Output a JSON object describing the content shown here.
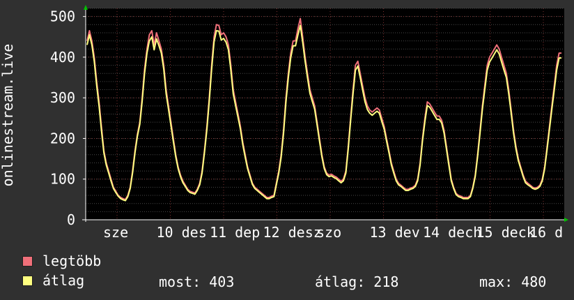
{
  "chart_data": {
    "type": "line",
    "ylabel": "onlinestream.live",
    "ylim": [
      0,
      520
    ],
    "y_ticks": [
      "0",
      "100",
      "200",
      "300",
      "400",
      "500"
    ],
    "x_ticks": [
      "sze",
      "10 des",
      "11 dep",
      "12 desz",
      "szo",
      "13 dev",
      "14 dech",
      "15 deck",
      "16 d"
    ],
    "grid": true,
    "series": [
      {
        "name": "legtöbb",
        "color": "#f0707a",
        "values": [
          440,
          465,
          440,
          400,
          340,
          290,
          230,
          170,
          140,
          120,
          100,
          80,
          70,
          60,
          55,
          52,
          50,
          60,
          80,
          120,
          170,
          210,
          240,
          300,
          370,
          420,
          455,
          465,
          430,
          460,
          440,
          420,
          380,
          320,
          280,
          240,
          200,
          160,
          130,
          110,
          95,
          85,
          75,
          70,
          68,
          66,
          75,
          90,
          120,
          170,
          230,
          300,
          380,
          450,
          480,
          478,
          455,
          460,
          450,
          430,
          380,
          320,
          290,
          260,
          230,
          190,
          160,
          130,
          110,
          90,
          80,
          75,
          70,
          65,
          60,
          55,
          55,
          58,
          60,
          90,
          120,
          160,
          220,
          300,
          360,
          410,
          440,
          440,
          470,
          495,
          450,
          400,
          360,
          320,
          300,
          280,
          240,
          200,
          160,
          130,
          115,
          110,
          112,
          108,
          105,
          100,
          95,
          100,
          120,
          180,
          250,
          320,
          380,
          390,
          360,
          330,
          300,
          280,
          270,
          265,
          270,
          275,
          270,
          250,
          230,
          200,
          170,
          140,
          120,
          100,
          90,
          85,
          80,
          75,
          75,
          78,
          80,
          85,
          100,
          140,
          200,
          250,
          290,
          285,
          275,
          265,
          255,
          255,
          245,
          220,
          180,
          140,
          100,
          80,
          65,
          60,
          58,
          55,
          55,
          55,
          60,
          80,
          110,
          160,
          220,
          280,
          330,
          380,
          400,
          410,
          420,
          430,
          420,
          400,
          380,
          360,
          320,
          270,
          220,
          180,
          150,
          130,
          110,
          95,
          90,
          85,
          80,
          78,
          80,
          85,
          100,
          130,
          180,
          230,
          280,
          330,
          380,
          410,
          410
        ]
      },
      {
        "name": "átlag",
        "color": "#ffff80",
        "values": [
          430,
          455,
          430,
          390,
          330,
          280,
          220,
          165,
          135,
          115,
          95,
          77,
          67,
          58,
          52,
          49,
          47,
          57,
          77,
          115,
          165,
          205,
          235,
          292,
          360,
          410,
          440,
          450,
          418,
          445,
          428,
          410,
          370,
          310,
          272,
          232,
          193,
          155,
          126,
          106,
          91,
          82,
          72,
          67,
          65,
          63,
          72,
          86,
          115,
          165,
          222,
          292,
          370,
          438,
          465,
          464,
          442,
          446,
          437,
          418,
          368,
          310,
          281,
          252,
          223,
          184,
          154,
          126,
          106,
          87,
          77,
          72,
          67,
          62,
          57,
          52,
          52,
          55,
          57,
          86,
          115,
          154,
          212,
          290,
          350,
          398,
          428,
          428,
          455,
          478,
          437,
          390,
          350,
          311,
          291,
          272,
          233,
          194,
          155,
          126,
          111,
          106,
          108,
          104,
          101,
          96,
          91,
          96,
          115,
          174,
          243,
          310,
          368,
          378,
          350,
          320,
          290,
          271,
          262,
          257,
          262,
          267,
          262,
          242,
          223,
          194,
          165,
          135,
          115,
          96,
          86,
          82,
          77,
          72,
          72,
          75,
          77,
          82,
          96,
          135,
          194,
          242,
          281,
          277,
          267,
          257,
          247,
          247,
          238,
          213,
          174,
          135,
          96,
          77,
          62,
          57,
          55,
          52,
          52,
          52,
          57,
          77,
          106,
          155,
          213,
          272,
          320,
          368,
          388,
          398,
          408,
          418,
          408,
          388,
          368,
          350,
          310,
          262,
          213,
          174,
          145,
          126,
          106,
          91,
          86,
          82,
          77,
          75,
          77,
          82,
          96,
          126,
          174,
          223,
          272,
          320,
          368,
          398,
          398
        ]
      }
    ],
    "stats": {
      "now_label": "most:",
      "now_value": "403",
      "avg_label": "átlag:",
      "avg_value": "218",
      "max_label": "max:",
      "max_value": "480"
    }
  }
}
